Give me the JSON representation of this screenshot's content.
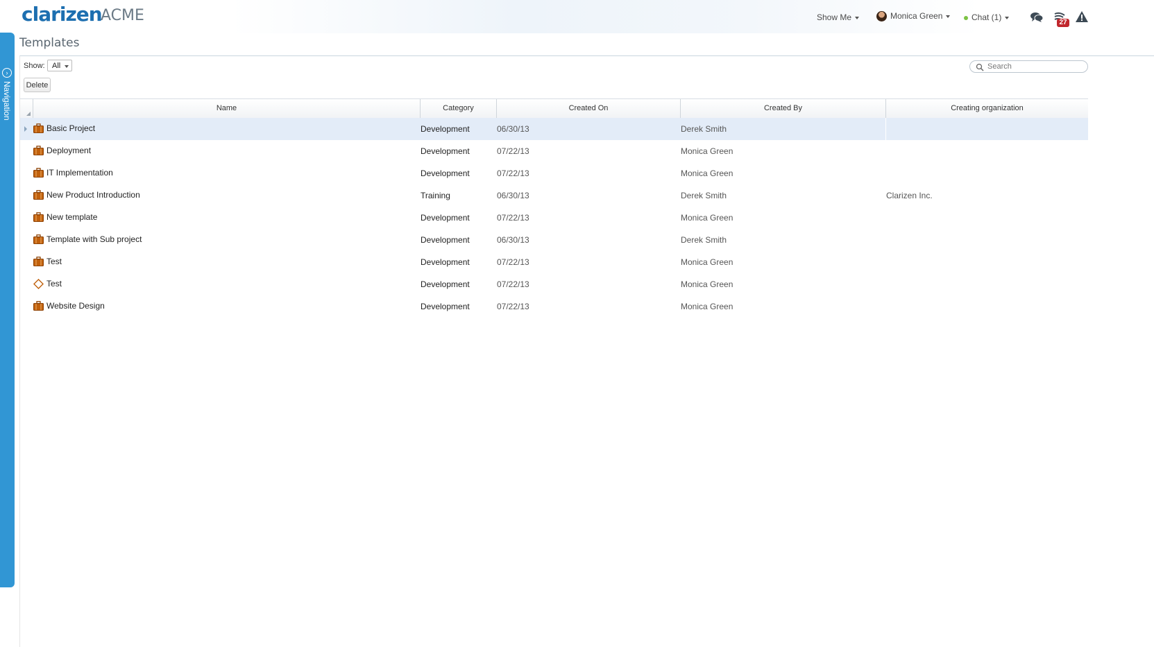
{
  "header": {
    "logo": "clarizen",
    "org": "ACME",
    "show_me": "Show Me",
    "user": "Monica Green",
    "chat": "Chat (1)",
    "notifications_count": "27"
  },
  "nav": {
    "label": "Navigation"
  },
  "page": {
    "title": "Templates"
  },
  "toolbar": {
    "show_label": "Show:",
    "show_value": "All",
    "delete_label": "Delete",
    "search_placeholder": "Search"
  },
  "grid": {
    "columns": [
      "Name",
      "Category",
      "Created On",
      "Created By",
      "Creating organization"
    ],
    "rows": [
      {
        "name": "Basic Project",
        "icon": "briefcase-icon",
        "category": "Development",
        "created_on": "06/30/13",
        "created_by": "Derek Smith",
        "org": "",
        "selected": true
      },
      {
        "name": "Deployment",
        "icon": "briefcase-icon",
        "category": "Development",
        "created_on": "07/22/13",
        "created_by": "Monica Green",
        "org": ""
      },
      {
        "name": "IT Implementation",
        "icon": "briefcase-icon",
        "category": "Development",
        "created_on": "07/22/13",
        "created_by": "Monica Green",
        "org": ""
      },
      {
        "name": "New Product Introduction",
        "icon": "briefcase-icon",
        "category": "Training",
        "created_on": "06/30/13",
        "created_by": "Derek Smith",
        "org": "Clarizen Inc."
      },
      {
        "name": "New template",
        "icon": "briefcase-icon",
        "category": "Development",
        "created_on": "07/22/13",
        "created_by": "Monica Green",
        "org": ""
      },
      {
        "name": "Template with Sub project",
        "icon": "briefcase-icon",
        "category": "Development",
        "created_on": "06/30/13",
        "created_by": "Derek Smith",
        "org": ""
      },
      {
        "name": "Test",
        "icon": "briefcase-icon",
        "category": "Development",
        "created_on": "07/22/13",
        "created_by": "Monica Green",
        "org": ""
      },
      {
        "name": "Test",
        "icon": "diamond-icon",
        "category": "Development",
        "created_on": "07/22/13",
        "created_by": "Monica Green",
        "org": ""
      },
      {
        "name": "Website Design",
        "icon": "briefcase-icon",
        "category": "Development",
        "created_on": "07/22/13",
        "created_by": "Monica Green",
        "org": ""
      }
    ]
  },
  "colors": {
    "brand": "#1d6fb0",
    "nav_rail": "#3196d4",
    "row_selected": "#e3ecf8",
    "badge": "#c0272d",
    "icon_orange": "#c0600c"
  }
}
